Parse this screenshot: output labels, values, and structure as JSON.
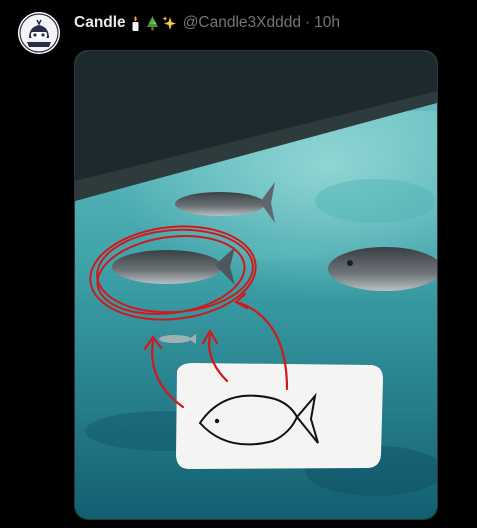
{
  "tweet": {
    "display_name": "Candle",
    "name_emojis": [
      "candle-emoji",
      "christmas-tree-emoji",
      "sparkles-emoji"
    ],
    "handle": "@Candle3Xdddd",
    "separator": "·",
    "timestamp": "10h"
  },
  "media": {
    "description_icon": "photo",
    "colors": {
      "water": "#3fa3aa",
      "annotation_red": "#d0191b"
    }
  }
}
